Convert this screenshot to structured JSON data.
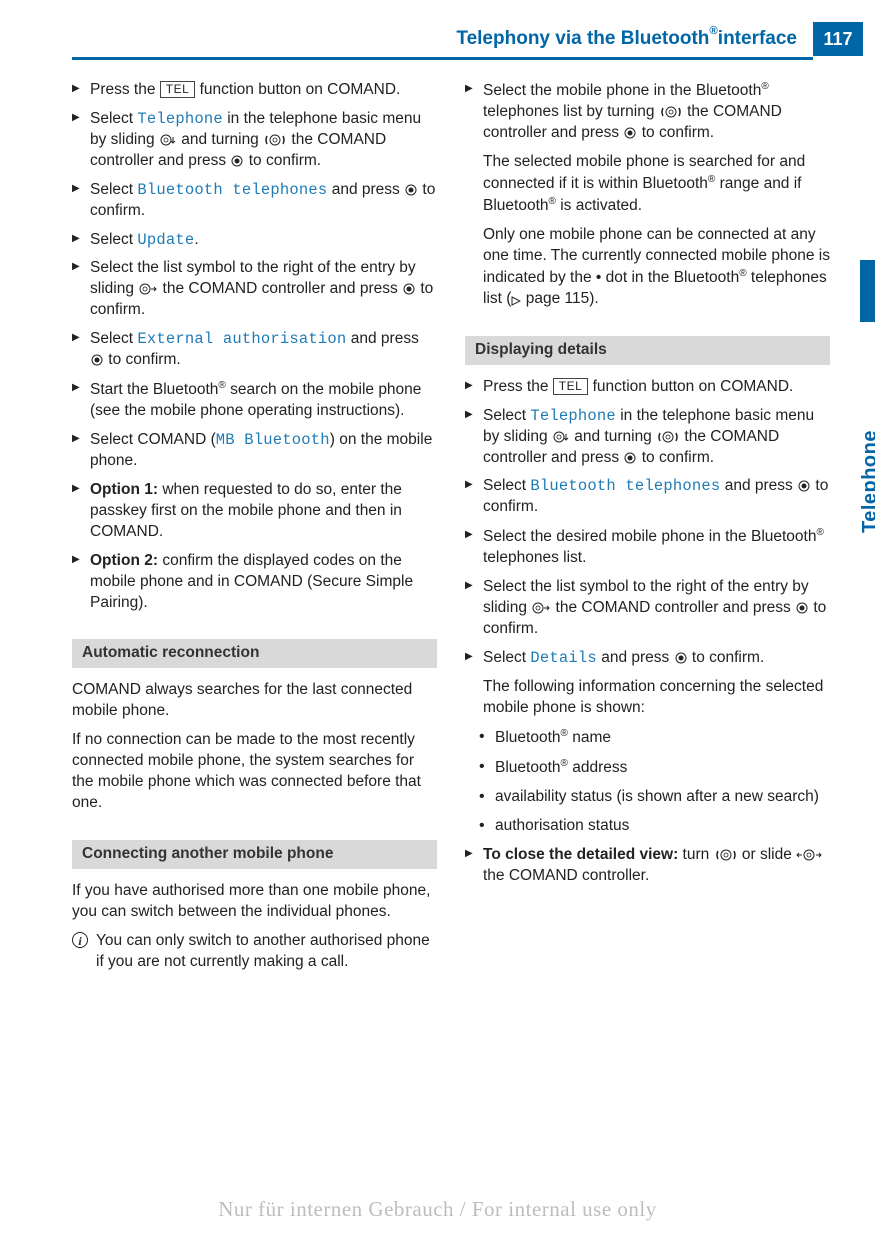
{
  "header": {
    "title_pre": "Telephony via the Bluetooth",
    "title_post": " interface",
    "pageno": "117"
  },
  "side_label": "Telephone",
  "common": {
    "tel_key": "TEL",
    "reg": "®"
  },
  "left": {
    "s1_a": "Press the ",
    "s1_b": " function button on COMAND.",
    "s2_a": "Select ",
    "s2_menu": "Telephone",
    "s2_b": " in the telephone basic menu by sliding ",
    "s2_c": " and turning ",
    "s2_d": " the COMAND controller and press ",
    "s2_e": " to confirm.",
    "s3_a": "Select ",
    "s3_menu": "Bluetooth telephones",
    "s3_b": " and press ",
    "s3_c": " to confirm.",
    "s4_a": "Select ",
    "s4_menu": "Update",
    "s4_b": ".",
    "s5_a": "Select the list symbol to the right of the entry by sliding ",
    "s5_b": " the COMAND controller and press ",
    "s5_c": " to confirm.",
    "s6_a": "Select ",
    "s6_menu": "External authorisation",
    "s6_b": " and press ",
    "s6_c": " to confirm.",
    "s7_a": "Start the Bluetooth",
    "s7_b": " search on the mobile phone (see the mobile phone operating instructions).",
    "s8_a": "Select COMAND (",
    "s8_menu": "MB Bluetooth",
    "s8_b": ") on the mobile phone.",
    "s9_a": "Option 1:",
    "s9_b": " when requested to do so, enter the passkey first on the mobile phone and then in COMAND.",
    "s10_a": " Option 2:",
    "s10_b": " confirm the displayed codes on the mobile phone and in COMAND (Secure Simple Pairing).",
    "h_auto": "Automatic reconnection",
    "p_auto1": "COMAND always searches for the last connected mobile phone.",
    "p_auto2": "If no connection can be made to the most recently connected mobile phone, the system searches for the mobile phone which was connected before that one.",
    "h_conn": "Connecting another mobile phone",
    "p_conn1": "If you have authorised more than one mobile phone, you can switch between the individual phones.",
    "info1": "You can only switch to another authorised phone if you are not currently making a call."
  },
  "right": {
    "s1_a": "Select the mobile phone in the Bluetooth",
    "s1_b": " telephones list by turning ",
    "s1_c": " the COMAND controller and press ",
    "s1_d": " to confirm.",
    "p1_a": "The selected mobile phone is searched for and connected if it is within Bluetooth",
    "p1_b": " range and if Bluetooth",
    "p1_c": " is activated.",
    "p2_a": "Only one mobile phone can be connected at any one time. The currently connected mobile phone is indicated by the  •  dot in the Bluetooth",
    "p2_b": " telephones list (",
    "p2_c": " page 115).",
    "h_det": "Displaying details",
    "s2_a": "Press the ",
    "s2_b": " function button on COMAND.",
    "s3_a": "Select ",
    "s3_menu": "Telephone",
    "s3_b": " in the telephone basic menu by sliding ",
    "s3_c": " and turning ",
    "s3_d": " the COMAND controller and press ",
    "s3_e": " to confirm.",
    "s4_a": "Select ",
    "s4_menu": "Bluetooth telephones",
    "s4_b": " and press ",
    "s4_c": " to confirm.",
    "s5_a": "Select the desired mobile phone in the Bluetooth",
    "s5_b": " telephones list.",
    "s6_a": "Select the list symbol to the right of the entry by sliding ",
    "s6_b": " the COMAND controller and press ",
    "s6_c": " to confirm.",
    "s7_a": "Select ",
    "s7_menu": "Details",
    "s7_b": " and press ",
    "s7_c": " to confirm.",
    "p3": "The following information concerning the selected mobile phone is shown:",
    "b1_a": "Bluetooth",
    "b1_b": " name",
    "b2_a": "Bluetooth",
    "b2_b": " address",
    "b3": "availability status (is shown after a new search)",
    "b4": "authorisation status",
    "s8_a": "To close the detailed view:",
    "s8_b": " turn ",
    "s8_c": " or slide ",
    "s8_d": " the COMAND controller."
  },
  "watermark": "Nur für internen Gebrauch / For internal use only"
}
